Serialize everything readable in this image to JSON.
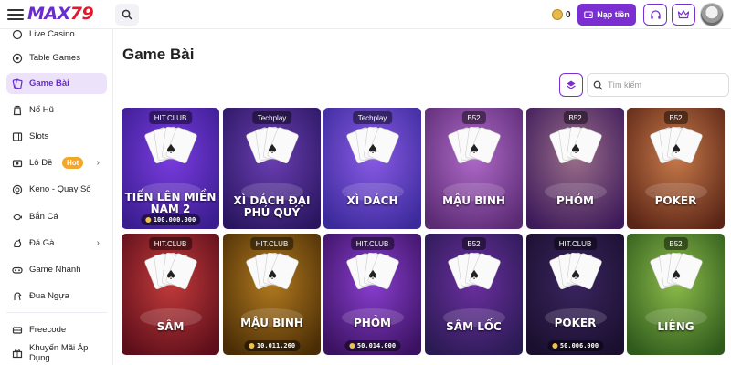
{
  "header": {
    "logo_main": "MAX",
    "logo_num": "79",
    "balance": "0",
    "deposit_label": "Nạp tiền",
    "icons": [
      "menu-icon",
      "search-icon",
      "coin-icon",
      "headset-icon",
      "crown-icon",
      "avatar"
    ]
  },
  "sidebar": {
    "items": [
      {
        "label": "Live Casino",
        "icon": "live-casino-icon"
      },
      {
        "label": "Table Games",
        "icon": "table-games-icon"
      },
      {
        "label": "Game Bài",
        "icon": "cards-icon",
        "active": true
      },
      {
        "label": "Nổ Hũ",
        "icon": "jar-icon"
      },
      {
        "label": "Slots",
        "icon": "slots-icon"
      },
      {
        "label": "Lô Đề",
        "icon": "lottery-icon",
        "badge": "Hot"
      },
      {
        "label": "Keno - Quay Số",
        "icon": "keno-icon"
      },
      {
        "label": "Bắn Cá",
        "icon": "fish-icon"
      },
      {
        "label": "Đá Gà",
        "icon": "rooster-icon"
      },
      {
        "label": "Game Nhanh",
        "icon": "gamepad-icon"
      },
      {
        "label": "Đua Ngựa",
        "icon": "horse-icon"
      },
      {
        "label": "Freecode",
        "icon": "freecode-icon"
      },
      {
        "label": "Khuyến Mãi Áp Dụng",
        "icon": "gift-icon"
      }
    ]
  },
  "main": {
    "title": "Game Bài",
    "search_placeholder": "Tìm kiếm"
  },
  "games": [
    {
      "name": "Tiến Lên Miền Nam 2",
      "provider": "HIT.CLUB",
      "jackpot": "100.000.000",
      "bg": [
        "#3a1d8f",
        "#7a3ce0"
      ]
    },
    {
      "name": "Xì Dách Đại Phú Quý",
      "provider": "Techplay",
      "jackpot": "",
      "bg": [
        "#2a1660",
        "#6b3fb3"
      ]
    },
    {
      "name": "Xì Dách",
      "provider": "Techplay",
      "jackpot": "",
      "bg": [
        "#3b2a9a",
        "#8a5be6"
      ]
    },
    {
      "name": "Mậu Binh",
      "provider": "B52",
      "jackpot": "",
      "bg": [
        "#5a2a73",
        "#b06ac9"
      ]
    },
    {
      "name": "Phỏm",
      "provider": "B52",
      "jackpot": "",
      "bg": [
        "#3d1a5a",
        "#9a6e8a"
      ]
    },
    {
      "name": "Poker",
      "provider": "B52",
      "jackpot": "",
      "bg": [
        "#5a2516",
        "#c87a4a"
      ]
    },
    {
      "name": "Sâm",
      "provider": "HIT.CLUB",
      "jackpot": "",
      "bg": [
        "#5c0e1a",
        "#c23b3b"
      ]
    },
    {
      "name": "Mậu Binh",
      "provider": "HIT.CLUB",
      "jackpot": "10.011.260",
      "bg": [
        "#4a2d06",
        "#b27a1f"
      ]
    },
    {
      "name": "Phỏm",
      "provider": "HIT.CLUB",
      "jackpot": "50.014.000",
      "bg": [
        "#3a1260",
        "#8a3ed0"
      ]
    },
    {
      "name": "Sâm Lốc",
      "provider": "B52",
      "jackpot": "",
      "bg": [
        "#2a1a52",
        "#6b2fa0"
      ]
    },
    {
      "name": "Poker",
      "provider": "HIT.CLUB",
      "jackpot": "50.006.000",
      "bg": [
        "#1a0f2e",
        "#3a2560"
      ]
    },
    {
      "name": "Liêng",
      "provider": "B52",
      "jackpot": "",
      "bg": [
        "#2f5a1c",
        "#8cbb4a"
      ]
    }
  ]
}
